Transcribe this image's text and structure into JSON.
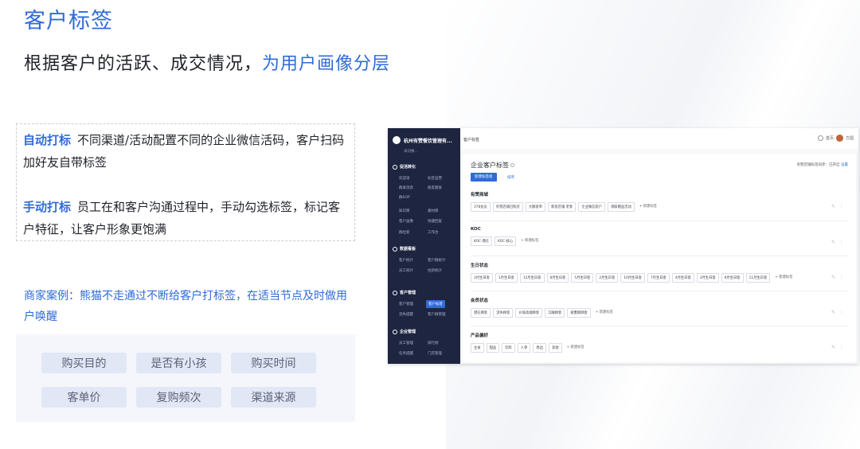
{
  "slide": {
    "title": "客户标签",
    "subtitle_main": "根据客户的活跃、成交情况，",
    "subtitle_highlight": "为用户画像分层",
    "auto_tag_label": "自动打标",
    "auto_tag_text": "不同渠道/活动配置不同的企业微信活码，客户扫码加好友自带标签",
    "manual_tag_label": "手动打标",
    "manual_tag_text": "员工在和客户沟通过程中，手动勾选标签，标记客户特征，让客户形象更饱满",
    "case_text": "商家案例：熊猫不走通过不断给客户打标签，在适当节点及时做用户唤醒",
    "example_tags": [
      "购买目的",
      "是否有小孩",
      "购买时间",
      "客单价",
      "复购频次",
      "渠道来源"
    ]
  },
  "app": {
    "brand": "杭州有赞餐饮管理有...",
    "brand_sub": "未切换...",
    "breadcrumb": "客户标签",
    "topbar_right": [
      "首页",
      "方圆"
    ],
    "nav": {
      "s1": "促活转化",
      "s1_items": [
        "欢迎语",
        "标签运营",
        "群发消息",
        "朋友圈发",
        "群SOP",
        "",
        "知识库",
        "素材库",
        "客户画像",
        "快捷回复",
        "群拉新",
        "工作台"
      ],
      "s2": "数据看板",
      "s2_items": [
        "客户统计",
        "客户群统计",
        "员工统计",
        "拉新统计"
      ],
      "s3": "客户管理",
      "s3_items": [
        "客户管理",
        "客户标签",
        "流失提醒",
        "客户群管理"
      ],
      "s4": "企业管理",
      "s4_items": [
        "员工管理",
        "排行榜",
        "任务提醒",
        "门店管理"
      ]
    },
    "page_title": "企业客户标签",
    "sync_note": "有赞店铺标签同步：已开启",
    "sync_link": "设置",
    "btn_new": "新建标签组",
    "btn_sort": "排序",
    "groups": [
      {
        "title": "有赞商城",
        "tags": [
          "378会员",
          "有赞店铺已购买",
          "大额客单",
          "新客店铺 老客",
          "企业微信客户",
          "领取赠品活动",
          "+ 新建标签"
        ]
      },
      {
        "title": "KOC",
        "tags": [
          "KOC-潜在",
          "KOC-核心",
          "+ 新建标签"
        ]
      },
      {
        "title": "生日状态",
        "tags": [
          "3月生日客",
          "1月生日客",
          "12月生日客",
          "8月生日客",
          "5月生日客",
          "2月生日客",
          "10月生日客",
          "7月生日客",
          "4月生日客",
          "3月生日客",
          "6月生日客",
          "11月生日客",
          "+ 新建标签"
        ]
      },
      {
        "title": "会员状态",
        "tags": [
          "潜在顾客",
          "流失顾客",
          "价值高端顾客",
          "沉睡顾客",
          "疲惫期顾客",
          "+ 新建标签"
        ]
      },
      {
        "title": "产品偏好",
        "tags": [
          "主食",
          "甜品",
          "饮料",
          "人参",
          "周边",
          "其他",
          "+ 新建标签"
        ]
      }
    ]
  }
}
